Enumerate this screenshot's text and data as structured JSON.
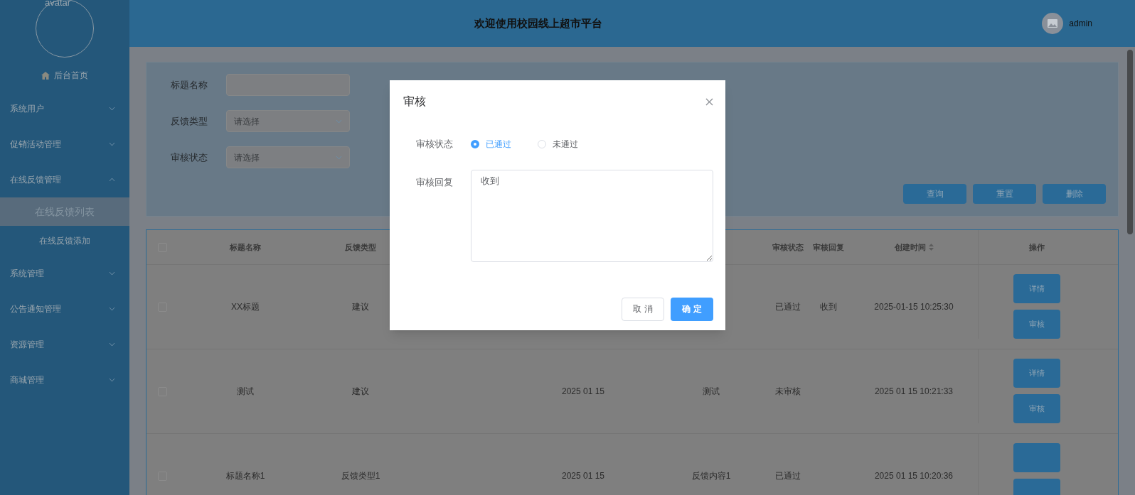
{
  "sidebar": {
    "avatar_alt": "avatar",
    "home": "后台首页",
    "items": [
      {
        "label": "系统用户",
        "expanded": false
      },
      {
        "label": "促销活动管理",
        "expanded": false
      },
      {
        "label": "在线反馈管理",
        "expanded": true,
        "children": [
          {
            "label": "在线反馈列表",
            "selected": true
          },
          {
            "label": "在线反馈添加",
            "selected": false
          }
        ]
      },
      {
        "label": "系统管理",
        "expanded": false
      },
      {
        "label": "公告通知管理",
        "expanded": false
      },
      {
        "label": "资源管理",
        "expanded": false
      },
      {
        "label": "商城管理",
        "expanded": false
      }
    ]
  },
  "header": {
    "title": "欢迎使用校园线上超市平台",
    "user": "admin"
  },
  "filters": [
    {
      "kind": "text",
      "label": "标题名称"
    },
    {
      "kind": "select",
      "label": "反馈类型",
      "placeholder": "请选择"
    },
    {
      "kind": "select",
      "label": "审核状态",
      "placeholder": "请选择"
    }
  ],
  "filter_buttons": [
    "查询",
    "重置",
    "删除"
  ],
  "table": {
    "all_checked": false,
    "columns": {
      "title": "标题名称",
      "type": "反馈类型",
      "status": "审核状态",
      "reply": "审核回复",
      "created": "创建时间",
      "ops": "操作"
    },
    "rows": [
      {
        "checked": false,
        "title": "XX标题",
        "type": "建议",
        "status": "已通过",
        "reply": "收到",
        "created": "2025-01-15 10:25:30",
        "actions": [
          "详情",
          "审核"
        ]
      },
      {
        "checked": false,
        "title": "测试",
        "type": "建议",
        "date": "2025 01 15",
        "content": "测试",
        "status": "未审核",
        "created": "2025 01 15 10:21:33",
        "actions": [
          "详情",
          "审核"
        ]
      },
      {
        "checked": false,
        "title": "标题名称1",
        "type": "反馈类型1",
        "date": "2025 01 15",
        "content": "反馈内容1",
        "status": "已通过",
        "created": "2025 01 15 10:20:36",
        "actions": []
      }
    ]
  },
  "dialog": {
    "title": "审核",
    "status_label": "审核状态",
    "options": [
      {
        "label": "已通过",
        "selected": true
      },
      {
        "label": "未通过",
        "selected": false
      }
    ],
    "reply_label": "审核回复",
    "reply_value": "收到",
    "buttons": [
      {
        "kind": "cancel",
        "label": "取 消"
      },
      {
        "kind": "confirm",
        "label": "确 定"
      }
    ]
  }
}
